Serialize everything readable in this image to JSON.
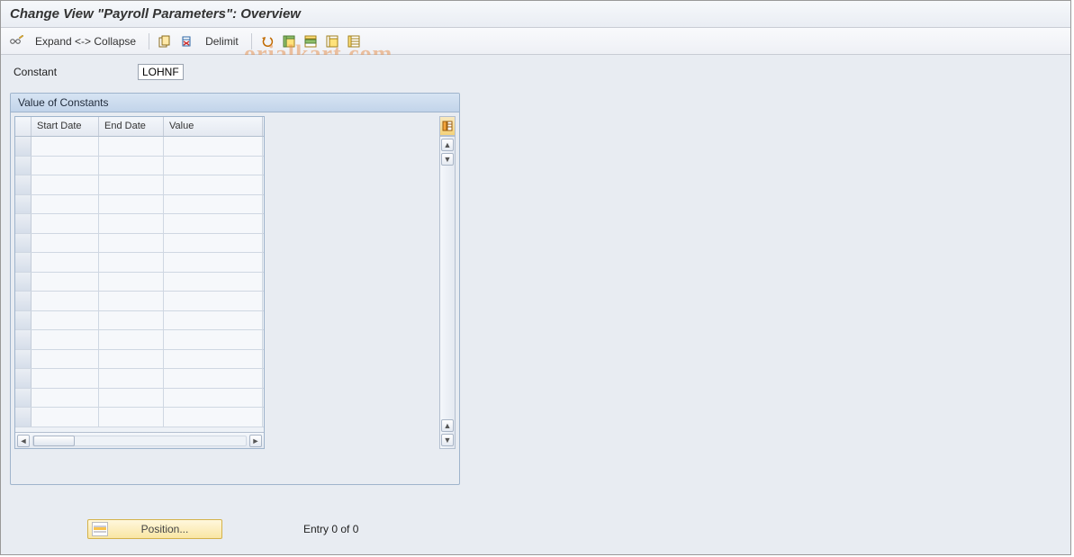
{
  "title": "Change View \"Payroll Parameters\": Overview",
  "toolbar": {
    "expand_collapse_label": "Expand <-> Collapse",
    "delimit_label": "Delimit"
  },
  "icons": {
    "glasses_pencil": "glasses-pencil-icon",
    "copy": "copy-icon",
    "delete": "delete-icon",
    "undo": "undo-icon",
    "select_all": "select-all-icon",
    "select_block": "select-block-icon",
    "deselect_all": "deselect-all-icon",
    "config": "config-icon",
    "table_settings": "table-settings-icon",
    "position": "position-icon"
  },
  "constant": {
    "label": "Constant",
    "value": "LOHNF"
  },
  "panel": {
    "title": "Value of Constants",
    "columns": {
      "start_date": "Start Date",
      "end_date": "End Date",
      "value": "Value"
    }
  },
  "footer": {
    "position_label": "Position...",
    "entry_text": "Entry 0 of 0"
  },
  "watermark": "orialkart.com"
}
